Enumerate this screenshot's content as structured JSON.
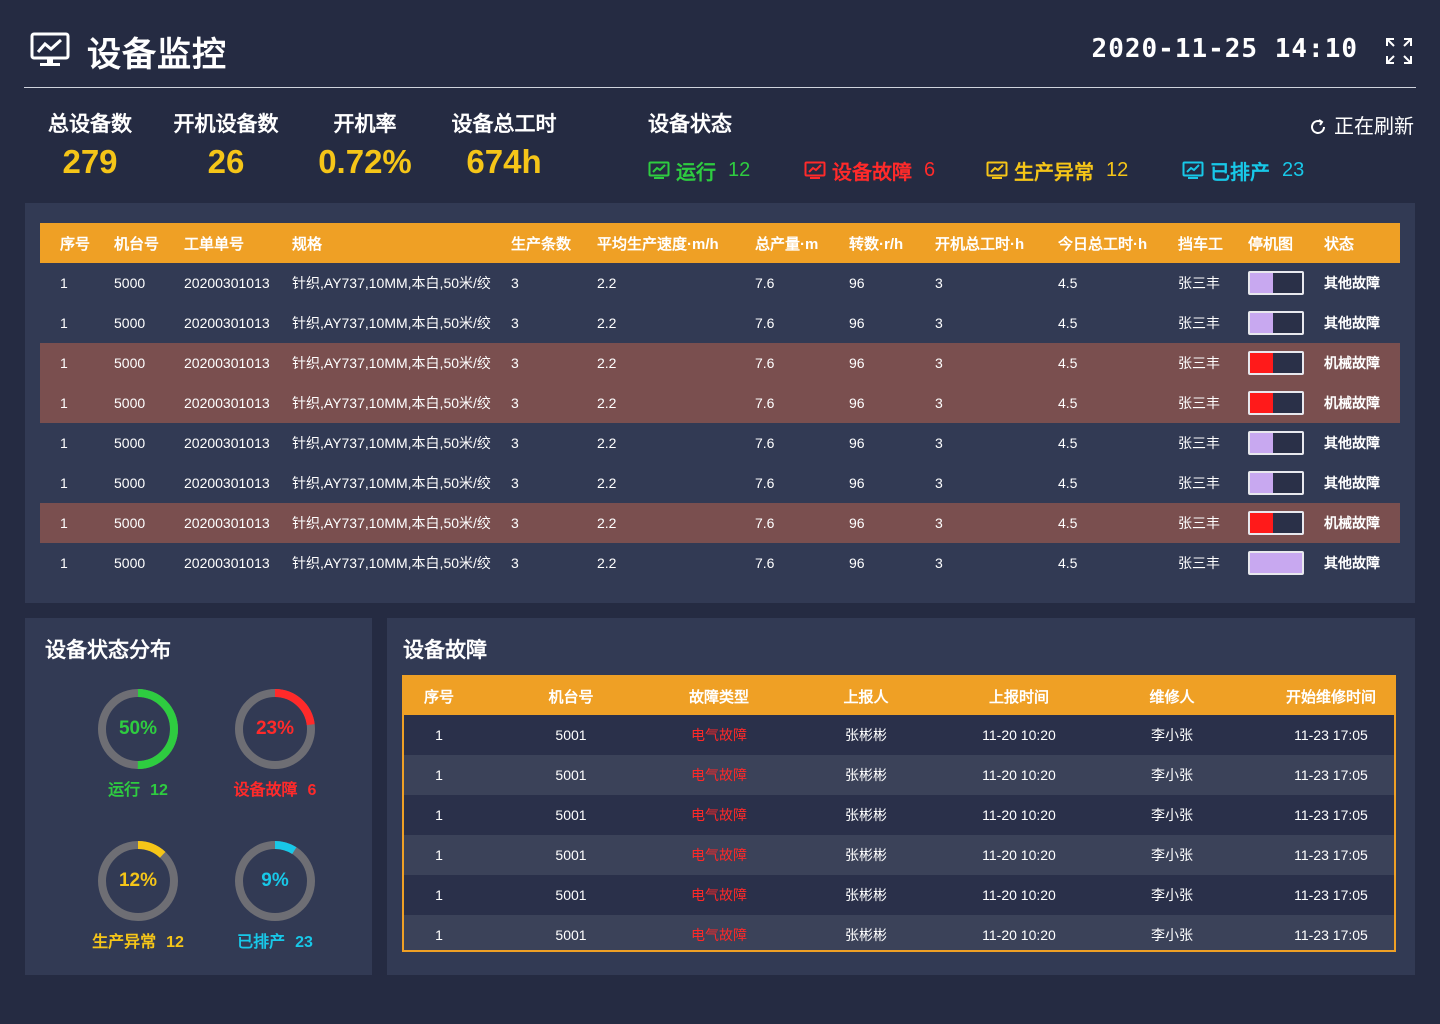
{
  "header": {
    "title": "设备监控",
    "datetime": "2020-11-25 14:10",
    "logo_icon": "monitor-chart-icon",
    "fullscreen_icon": "fullscreen-icon"
  },
  "stats": {
    "total_devices": {
      "label": "总设备数",
      "value": "279"
    },
    "running_devices": {
      "label": "开机设备数",
      "value": "26"
    },
    "run_rate": {
      "label": "开机率",
      "value": "0.72%"
    },
    "total_hours": {
      "label": "设备总工时",
      "value": "674h"
    }
  },
  "status": {
    "title": "设备状态",
    "refresh_label": "正在刷新",
    "items": [
      {
        "label": "运行",
        "count": "12",
        "color": "#2ecc40"
      },
      {
        "label": "设备故障",
        "count": "6",
        "color": "#ff2a2a"
      },
      {
        "label": "生产异常",
        "count": "12",
        "color": "#f5c518"
      },
      {
        "label": "已排产",
        "count": "23",
        "color": "#18c8e8"
      }
    ]
  },
  "machine_table": {
    "headers": [
      "序号",
      "机台号",
      "工单单号",
      "规格",
      "生产条数",
      "平均生产速度·m/h",
      "总产量·m",
      "转数·r/h",
      "开机总工时·h",
      "今日总工时·h",
      "挡车工",
      "停机图",
      "状态"
    ],
    "rows": [
      {
        "seq": "1",
        "machine": "5000",
        "order": "20200301013",
        "spec": "针织,AY737,10MM,本白,50米/绞",
        "count": "3",
        "speed": "2.2",
        "output": "7.6",
        "rpm": "96",
        "total_hours": "3",
        "today_hours": "4.5",
        "worker": "张三丰",
        "stop_fill": 0.45,
        "stop_color": "#c8a8f0",
        "status": "其他故障",
        "fault": false
      },
      {
        "seq": "1",
        "machine": "5000",
        "order": "20200301013",
        "spec": "针织,AY737,10MM,本白,50米/绞",
        "count": "3",
        "speed": "2.2",
        "output": "7.6",
        "rpm": "96",
        "total_hours": "3",
        "today_hours": "4.5",
        "worker": "张三丰",
        "stop_fill": 0.45,
        "stop_color": "#c8a8f0",
        "status": "其他故障",
        "fault": false
      },
      {
        "seq": "1",
        "machine": "5000",
        "order": "20200301013",
        "spec": "针织,AY737,10MM,本白,50米/绞",
        "count": "3",
        "speed": "2.2",
        "output": "7.6",
        "rpm": "96",
        "total_hours": "3",
        "today_hours": "4.5",
        "worker": "张三丰",
        "stop_fill": 0.45,
        "stop_color": "#ff1a1a",
        "status": "机械故障",
        "fault": true
      },
      {
        "seq": "1",
        "machine": "5000",
        "order": "20200301013",
        "spec": "针织,AY737,10MM,本白,50米/绞",
        "count": "3",
        "speed": "2.2",
        "output": "7.6",
        "rpm": "96",
        "total_hours": "3",
        "today_hours": "4.5",
        "worker": "张三丰",
        "stop_fill": 0.45,
        "stop_color": "#ff1a1a",
        "status": "机械故障",
        "fault": true
      },
      {
        "seq": "1",
        "machine": "5000",
        "order": "20200301013",
        "spec": "针织,AY737,10MM,本白,50米/绞",
        "count": "3",
        "speed": "2.2",
        "output": "7.6",
        "rpm": "96",
        "total_hours": "3",
        "today_hours": "4.5",
        "worker": "张三丰",
        "stop_fill": 0.45,
        "stop_color": "#c8a8f0",
        "status": "其他故障",
        "fault": false
      },
      {
        "seq": "1",
        "machine": "5000",
        "order": "20200301013",
        "spec": "针织,AY737,10MM,本白,50米/绞",
        "count": "3",
        "speed": "2.2",
        "output": "7.6",
        "rpm": "96",
        "total_hours": "3",
        "today_hours": "4.5",
        "worker": "张三丰",
        "stop_fill": 0.45,
        "stop_color": "#c8a8f0",
        "status": "其他故障",
        "fault": false
      },
      {
        "seq": "1",
        "machine": "5000",
        "order": "20200301013",
        "spec": "针织,AY737,10MM,本白,50米/绞",
        "count": "3",
        "speed": "2.2",
        "output": "7.6",
        "rpm": "96",
        "total_hours": "3",
        "today_hours": "4.5",
        "worker": "张三丰",
        "stop_fill": 0.45,
        "stop_color": "#ff1a1a",
        "status": "机械故障",
        "fault": true
      },
      {
        "seq": "1",
        "machine": "5000",
        "order": "20200301013",
        "spec": "针织,AY737,10MM,本白,50米/绞",
        "count": "3",
        "speed": "2.2",
        "output": "7.6",
        "rpm": "96",
        "total_hours": "3",
        "today_hours": "4.5",
        "worker": "张三丰",
        "stop_fill": 1.0,
        "stop_color": "#c8a8f0",
        "status": "其他故障",
        "fault": false
      }
    ]
  },
  "distribution": {
    "title": "设备状态分布",
    "items": [
      {
        "pct_label": "50%",
        "pct": 0.5,
        "label": "运行",
        "count": "12",
        "color": "#2ecc40"
      },
      {
        "pct_label": "23%",
        "pct": 0.23,
        "label": "设备故障",
        "count": "6",
        "color": "#ff2a2a"
      },
      {
        "pct_label": "12%",
        "pct": 0.12,
        "label": "生产异常",
        "count": "12",
        "color": "#f5c518"
      },
      {
        "pct_label": "9%",
        "pct": 0.09,
        "label": "已排产",
        "count": "23",
        "color": "#18c8e8"
      }
    ]
  },
  "faults": {
    "title": "设备故障",
    "headers": [
      "序号",
      "机台号",
      "故障类型",
      "上报人",
      "上报时间",
      "维修人",
      "开始维修时间"
    ],
    "rows": [
      {
        "seq": "1",
        "machine": "5001",
        "type": "电气故障",
        "reporter": "张彬彬",
        "report_time": "11-20 10:20",
        "repairer": "李小张",
        "repair_time": "11-23 17:05"
      },
      {
        "seq": "1",
        "machine": "5001",
        "type": "电气故障",
        "reporter": "张彬彬",
        "report_time": "11-20 10:20",
        "repairer": "李小张",
        "repair_time": "11-23 17:05"
      },
      {
        "seq": "1",
        "machine": "5001",
        "type": "电气故障",
        "reporter": "张彬彬",
        "report_time": "11-20 10:20",
        "repairer": "李小张",
        "repair_time": "11-23 17:05"
      },
      {
        "seq": "1",
        "machine": "5001",
        "type": "电气故障",
        "reporter": "张彬彬",
        "report_time": "11-20 10:20",
        "repairer": "李小张",
        "repair_time": "11-23 17:05"
      },
      {
        "seq": "1",
        "machine": "5001",
        "type": "电气故障",
        "reporter": "张彬彬",
        "report_time": "11-20 10:20",
        "repairer": "李小张",
        "repair_time": "11-23 17:05"
      },
      {
        "seq": "1",
        "machine": "5001",
        "type": "电气故障",
        "reporter": "张彬彬",
        "report_time": "11-20 10:20",
        "repairer": "李小张",
        "repair_time": "11-23 17:05"
      }
    ]
  }
}
